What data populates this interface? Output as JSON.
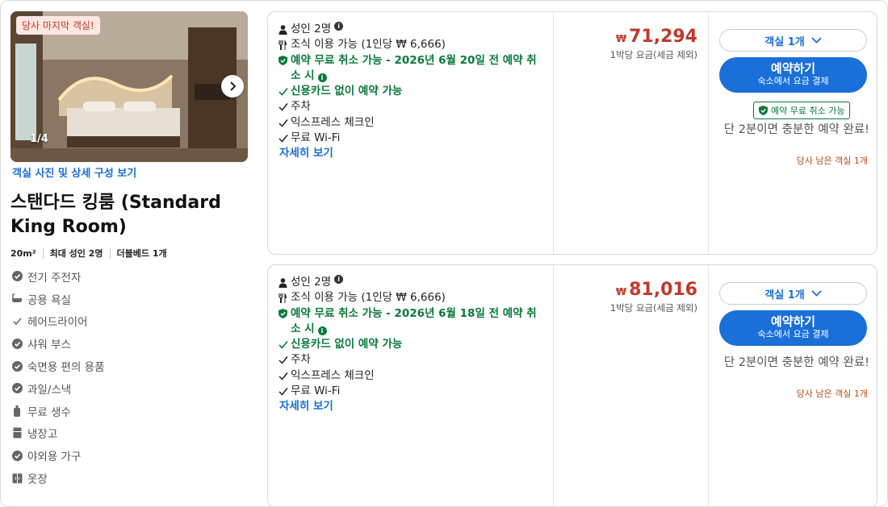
{
  "room": {
    "photo_badge": "당사 마지막 객실!",
    "photo_counter": "1/4",
    "photo_link": "객실 사진 및 상세 구성 보기",
    "name": "스탠다드 킹룸 (Standard King Room)",
    "specs": [
      "20m²",
      "최대 성인 2명",
      "더블베드 1개"
    ],
    "amenities": [
      {
        "icon": "check-circle-icon",
        "label": "전기 주전자"
      },
      {
        "icon": "bathtub-icon",
        "label": "공용 욕실"
      },
      {
        "icon": "check-icon",
        "label": "헤어드라이어"
      },
      {
        "icon": "check-circle-icon",
        "label": "샤워 부스"
      },
      {
        "icon": "check-circle-icon",
        "label": "숙면용 편의 용품"
      },
      {
        "icon": "check-circle-icon",
        "label": "과일/스낵"
      },
      {
        "icon": "water-bottle-icon",
        "label": "무료 생수"
      },
      {
        "icon": "fridge-icon",
        "label": "냉장고"
      },
      {
        "icon": "check-circle-icon",
        "label": "야외용 가구"
      },
      {
        "icon": "wardrobe-icon",
        "label": "옷장"
      }
    ]
  },
  "offers": [
    {
      "guests": "성인 2명",
      "breakfast": "조식 이용 가능 (1인당 ₩ 6,666)",
      "cancellation": "예약 무료 취소 가능 - 2026년 6월 20일 전 예약 취소 시",
      "no_card": "신용카드 없이 예약 가능",
      "features": [
        "주차",
        "익스프레스 체크인",
        "무료 Wi-Fi"
      ],
      "more": "자세히 보기",
      "currency": "₩",
      "price": "71,294",
      "price_note": "1박당 요금(세금 제외)",
      "qty_label": "객실 1개",
      "book_label": "예약하기",
      "book_sub": "숙소에서 요금 결제",
      "free_tag": "예약 무료 취소 가능",
      "fast_text": "단 2분이면 충분한 예약 완료!",
      "rooms_left": "당사 남은 객실 1개"
    },
    {
      "guests": "성인 2명",
      "breakfast": "조식 이용 가능 (1인당 ₩ 6,666)",
      "cancellation": "예약 무료 취소 가능 - 2026년 6월 18일 전 예약 취소 시",
      "no_card": "신용카드 없이 예약 가능",
      "features": [
        "주차",
        "익스프레스 체크인",
        "무료 Wi-Fi"
      ],
      "more": "자세히 보기",
      "currency": "₩",
      "price": "81,016",
      "price_note": "1박당 요금(세금 제외)",
      "qty_label": "객실 1개",
      "book_label": "예약하기",
      "book_sub": "숙소에서 요금 결제",
      "fast_text": "단 2분이면 충분한 예약 완료!",
      "rooms_left": "당사 남은 객실 1개"
    }
  ],
  "colors": {
    "accent": "#1a6fd9",
    "price": "#c0392b",
    "green": "#0b7a3b",
    "urgent": "#b5521b"
  }
}
